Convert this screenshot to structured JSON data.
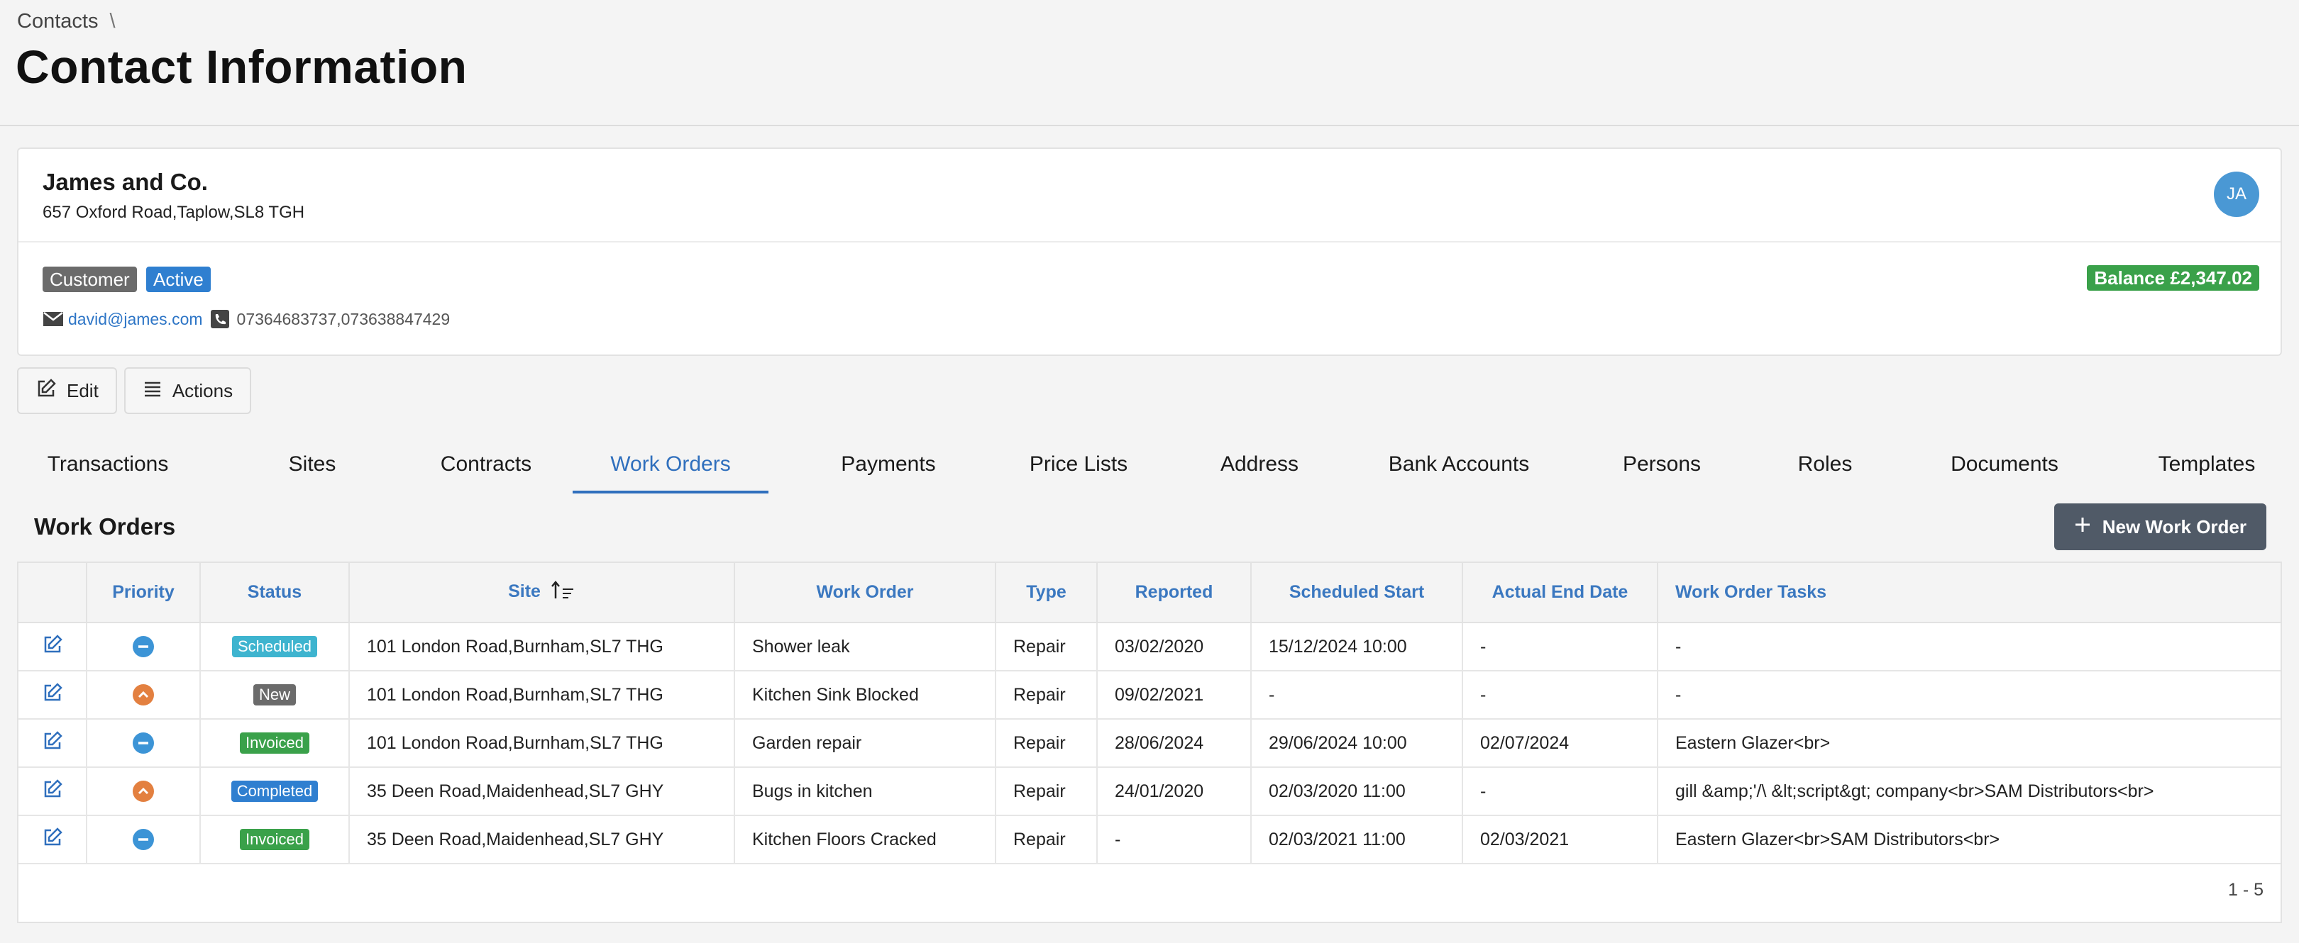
{
  "breadcrumb": {
    "root": "Contacts",
    "separator": "\\"
  },
  "page": {
    "title": "Contact Information"
  },
  "contact": {
    "name": "James and Co.",
    "address": "657 Oxford Road,Taplow,SL8 TGH",
    "avatar_initials": "JA",
    "tags": {
      "customer": "Customer",
      "active": "Active"
    },
    "balance": "Balance £2,347.02",
    "email": "david@james.com",
    "phones": "07364683737,073638847429"
  },
  "toolbar": {
    "edit_label": "Edit",
    "actions_label": "Actions"
  },
  "tabs": [
    {
      "label": "Transactions"
    },
    {
      "label": "Sites"
    },
    {
      "label": "Contracts"
    },
    {
      "label": "Work Orders"
    },
    {
      "label": "Payments"
    },
    {
      "label": "Price Lists"
    },
    {
      "label": "Address"
    },
    {
      "label": "Bank Accounts"
    },
    {
      "label": "Persons"
    },
    {
      "label": "Roles"
    },
    {
      "label": "Documents"
    },
    {
      "label": "Templates"
    }
  ],
  "active_tab": "Work Orders",
  "work_orders": {
    "title": "Work Orders",
    "new_button": "New Work Order",
    "columns": [
      "Priority",
      "Status",
      "Site",
      "Work Order",
      "Type",
      "Reported",
      "Scheduled Start",
      "Actual End Date",
      "Work Order Tasks"
    ],
    "sorted_column": "Site",
    "rows": [
      {
        "priority": "normal",
        "status": "Scheduled",
        "status_color": "#3eb4cf",
        "site": "101 London Road,Burnham,SL7 THG",
        "work_order": "Shower leak",
        "type": "Repair",
        "reported": "03/02/2020",
        "scheduled_start": "15/12/2024 10:00",
        "actual_end": "-",
        "tasks": "-"
      },
      {
        "priority": "high",
        "status": "New",
        "status_color": "#6b6b6b",
        "site": "101 London Road,Burnham,SL7 THG",
        "work_order": "Kitchen Sink Blocked",
        "type": "Repair",
        "reported": "09/02/2021",
        "scheduled_start": "-",
        "actual_end": "-",
        "tasks": "-"
      },
      {
        "priority": "normal",
        "status": "Invoiced",
        "status_color": "#3aa14a",
        "site": "101 London Road,Burnham,SL7 THG",
        "work_order": "Garden repair",
        "type": "Repair",
        "reported": "28/06/2024",
        "scheduled_start": "29/06/2024 10:00",
        "actual_end": "02/07/2024",
        "tasks": "Eastern Glazer<br>"
      },
      {
        "priority": "high",
        "status": "Completed",
        "status_color": "#2f7fd0",
        "site": "35 Deen Road,Maidenhead,SL7 GHY",
        "work_order": "Bugs in kitchen",
        "type": "Repair",
        "reported": "24/01/2020",
        "scheduled_start": "02/03/2020 11:00",
        "actual_end": "-",
        "tasks": "gill &amp;'/\\ &lt;script&gt; company<br>SAM Distributors<br>"
      },
      {
        "priority": "normal",
        "status": "Invoiced",
        "status_color": "#3aa14a",
        "site": "35 Deen Road,Maidenhead,SL7 GHY",
        "work_order": "Kitchen Floors Cracked",
        "type": "Repair",
        "reported": "-",
        "scheduled_start": "02/03/2021 11:00",
        "actual_end": "02/03/2021",
        "tasks": "Eastern Glazer<br>SAM Distributors<br>"
      }
    ],
    "pagination": "1 - 5"
  }
}
